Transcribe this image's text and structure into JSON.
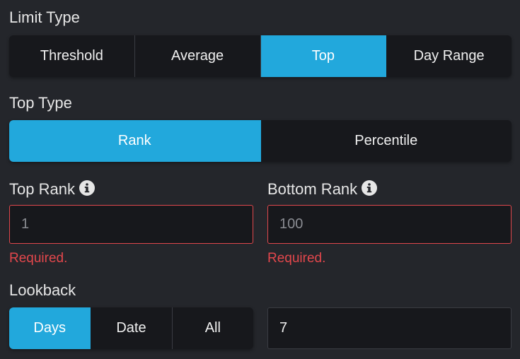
{
  "limit_type": {
    "label": "Limit Type",
    "options": [
      "Threshold",
      "Average",
      "Top",
      "Day Range"
    ],
    "selected": "Top"
  },
  "top_type": {
    "label": "Top Type",
    "options": [
      "Rank",
      "Percentile"
    ],
    "selected": "Rank"
  },
  "top_rank": {
    "label": "Top Rank",
    "placeholder": "1",
    "error": "Required."
  },
  "bottom_rank": {
    "label": "Bottom Rank",
    "placeholder": "100",
    "error": "Required."
  },
  "lookback": {
    "label": "Lookback",
    "options": [
      "Days",
      "Date",
      "All"
    ],
    "selected": "Days",
    "value": "7"
  },
  "icons": {
    "info": "info-circle-icon"
  },
  "colors": {
    "accent": "#22a8dc",
    "error": "#e3474c",
    "background": "#24262b",
    "control_bg": "#17181c"
  }
}
